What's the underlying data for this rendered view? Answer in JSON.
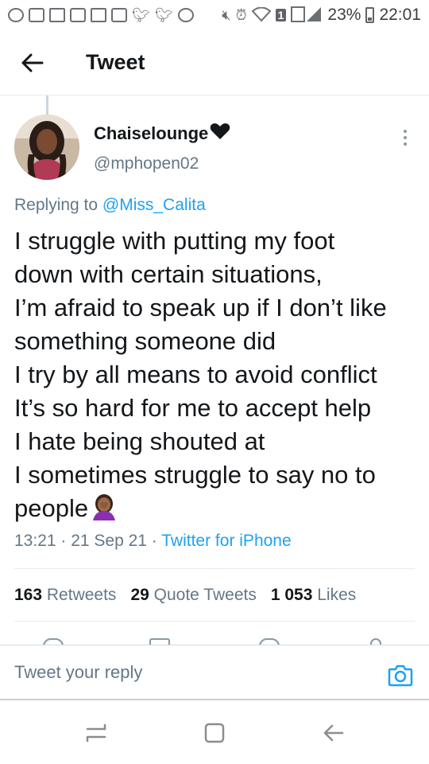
{
  "status_bar": {
    "battery_percent": "23%",
    "time": "22:01",
    "sim_badge": "1"
  },
  "header": {
    "title": "Tweet"
  },
  "author": {
    "display_name": "Chaiselounge",
    "handle": "@mphopen02"
  },
  "replying": {
    "prefix": "Replying to",
    "mention": "@Miss_Calita"
  },
  "tweet": {
    "lines": [
      "I struggle with putting my foot",
      "down with certain situations,",
      "I’m afraid to speak up if I don’t like",
      "something someone did",
      "I try by all means to avoid conflict",
      "It’s so hard for me to accept help",
      "I hate being shouted at",
      "I sometimes struggle to say no to",
      "people"
    ],
    "timestamp": "13:21 · 21 Sep 21 · ",
    "source": "Twitter for iPhone"
  },
  "stats": {
    "retweets_count": "163",
    "retweets_label": "Retweets",
    "quotes_count": "29",
    "quotes_label": "Quote Tweets",
    "likes_count": "1 053",
    "likes_label": "Likes"
  },
  "reply_bar": {
    "placeholder": "Tweet your reply"
  },
  "colors": {
    "accent": "#1da1f2",
    "secondary_text": "#657786",
    "primary_text": "#14171a"
  }
}
